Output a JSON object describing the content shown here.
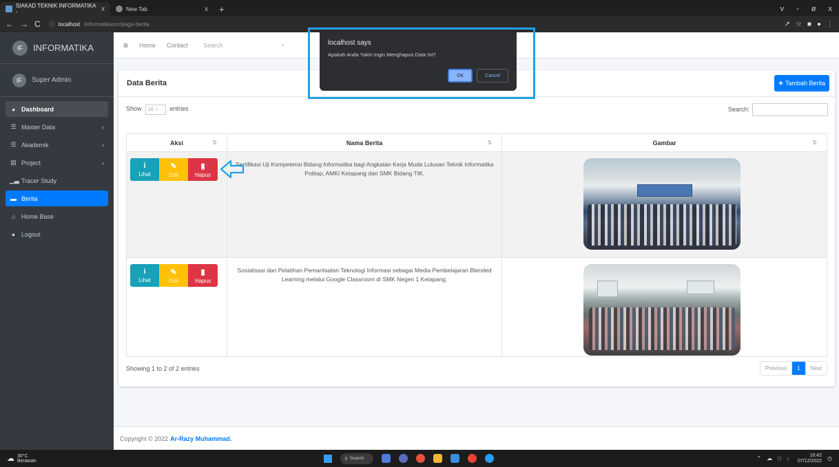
{
  "browser": {
    "tabs": [
      {
        "title": "SIAKAD TEKNIK INFORMATIKA - ",
        "close": "x"
      },
      {
        "title": "New Tab",
        "close": "x"
      }
    ],
    "new_tab": "+",
    "window_controls": [
      "v",
      "-",
      "ø",
      "x"
    ],
    "url_host": "localhost",
    "url_path": "/informatikaonr/page-berita",
    "nav_back": "←",
    "nav_forward": "→",
    "nav_reload": "C"
  },
  "sidebar": {
    "brand_logo": "IF",
    "brand": "INFORMATIKA",
    "user_avatar": "IF",
    "user": "Super Admin",
    "items": [
      {
        "label": "Dashboard",
        "icon": "dashboard-icon",
        "glyph": "◕",
        "arrow": ""
      },
      {
        "label": "Master Data",
        "icon": "list-icon",
        "glyph": "☰",
        "arrow": "‹"
      },
      {
        "label": "Akademik",
        "icon": "list-icon",
        "glyph": "☰",
        "arrow": "‹"
      },
      {
        "label": "Project",
        "icon": "database-icon",
        "glyph": "▤",
        "arrow": "‹"
      },
      {
        "label": "Tracer Study",
        "icon": "chart-icon",
        "glyph": "▁▃",
        "arrow": ""
      },
      {
        "label": "Berita",
        "icon": "newspaper-icon",
        "glyph": "▬",
        "arrow": ""
      },
      {
        "label": "Home Base",
        "icon": "home-icon",
        "glyph": "⌂",
        "arrow": ""
      },
      {
        "label": "Logout",
        "icon": "logout-icon",
        "glyph": "●",
        "arrow": ""
      }
    ]
  },
  "topnav": {
    "menu_icon": "≡",
    "home": "Home",
    "contact": "Contact",
    "search_placeholder": "Search",
    "search_icon": "⌕"
  },
  "card": {
    "title": "Data Berita",
    "add_button": "Tambah Berita",
    "add_icon": "+",
    "show_label": "Show",
    "show_value": "10",
    "entries_label": "entries",
    "search_label": "Search:"
  },
  "table": {
    "headers": [
      "Aksi",
      "Nama Berita",
      "Gambar"
    ],
    "sort_icon": "⇅",
    "buttons": {
      "lihat": "Lihat",
      "edit": "Edit",
      "hapus": "Hapus",
      "lihat_icon": "i",
      "edit_icon": "✎",
      "hapus_icon": "▮"
    },
    "rows": [
      {
        "nama": "Sertifikasi Uji Kompetensi Bidang Informatika bagi Angkatan Kerja Muda Lulusan Teknik Informatika Politap, AMKI Ketapang dan SMK Bidang TIK."
      },
      {
        "nama": "Sosialisasi dan Pelatihan Pemanfaatan Teknologi Informasi sebagai Media Pembelajaran Blended Learning melalui Google Classroom di SMK Negeri 1 Ketapang."
      }
    ]
  },
  "dt_footer": {
    "info": "Showing 1 to 2 of 2 entries",
    "previous": "Previous",
    "page": "1",
    "next": "Next"
  },
  "footer": {
    "copyright": "Copyright © 2022",
    "author": "Ar-Razy Muhammad."
  },
  "dialog": {
    "title": "localhost says",
    "message": "Apakah Anda Yakin Ingin Menghapus Data Ini?",
    "ok": "OK",
    "cancel": "Cancel",
    "highlight_color": "#1ea1e6"
  },
  "taskbar": {
    "temp": "30°C",
    "weather": "Berawan",
    "search": "Search",
    "time": "16:42",
    "date": "07/12/2022",
    "lang": "↑↓"
  },
  "colors": {
    "primary": "#007bff",
    "info": "#17a2b8",
    "warning": "#ffc107",
    "danger": "#dc3545",
    "sidebar": "#343a40"
  }
}
